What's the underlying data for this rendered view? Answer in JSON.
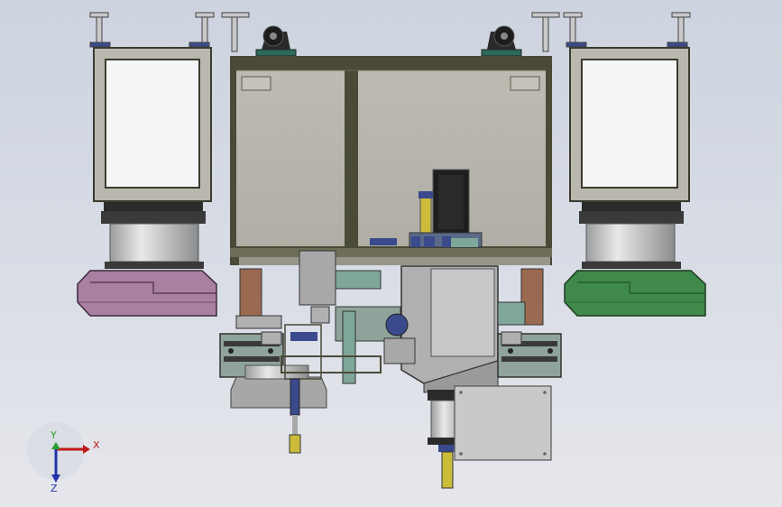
{
  "viewport": {
    "background_top": "#cdd4df",
    "background_bottom": "#e6e7ec"
  },
  "model": {
    "frame_color": "#4a4a38",
    "panel_fill": "#b7b5ac",
    "left_bin_color": "#a97fa2",
    "right_bin_color": "#3f8a4a",
    "rail_color": "#8fa39a",
    "motor_color": "#3a4a8c",
    "accent_yellow": "#cbbd3a",
    "bracket_brown": "#9a6a50"
  },
  "triad": {
    "x_label": "X",
    "y_label": "Y",
    "z_label": "Z",
    "x_color": "#c21818",
    "y_color": "#26a02e",
    "z_color": "#2233aa"
  }
}
